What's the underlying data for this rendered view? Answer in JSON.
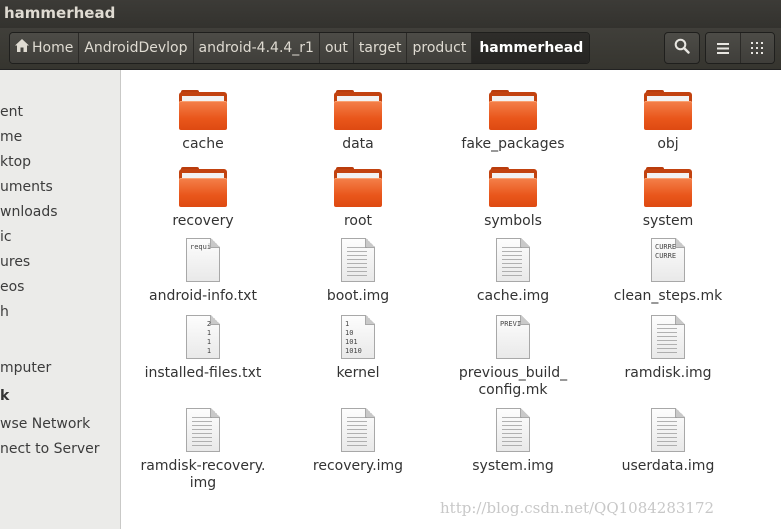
{
  "window": {
    "title": "hammerhead"
  },
  "breadcrumb": {
    "items": [
      "Home",
      "AndroidDevlop",
      "android-4.4.4_r1",
      "out",
      "target",
      "product",
      "hammerhead"
    ]
  },
  "toolbar": {
    "search_icon": "search-icon",
    "list_view_icon": "list-view-icon",
    "grid_view_icon": "grid-view-icon"
  },
  "sidebar": {
    "items": [
      "ent",
      "me",
      "ktop",
      "uments",
      "wnloads",
      "ic",
      "ures",
      "eos",
      "h",
      "mputer",
      "k",
      "wse Network",
      "nect to Server"
    ]
  },
  "files": [
    {
      "name": "cache",
      "type": "folder"
    },
    {
      "name": "data",
      "type": "folder"
    },
    {
      "name": "fake_packages",
      "type": "folder"
    },
    {
      "name": "obj",
      "type": "folder"
    },
    {
      "name": "recovery",
      "type": "folder"
    },
    {
      "name": "root",
      "type": "folder"
    },
    {
      "name": "symbols",
      "type": "folder"
    },
    {
      "name": "system",
      "type": "folder"
    },
    {
      "name": "android-info.txt",
      "type": "text",
      "preview": "requi"
    },
    {
      "name": "boot.img",
      "type": "file"
    },
    {
      "name": "cache.img",
      "type": "file"
    },
    {
      "name": "clean_steps.mk",
      "type": "text",
      "preview": "CURRE\nCURRE"
    },
    {
      "name": "installed-files.txt",
      "type": "text",
      "preview": "    2\n    1\n    1\n    1"
    },
    {
      "name": "kernel",
      "type": "text",
      "preview": "1\n10\n101\n1010"
    },
    {
      "name": "previous_build_\nconfig.mk",
      "type": "text",
      "preview": "PREVI"
    },
    {
      "name": "ramdisk.img",
      "type": "file"
    },
    {
      "name": "ramdisk-recovery.\nimg",
      "type": "file"
    },
    {
      "name": "recovery.img",
      "type": "file"
    },
    {
      "name": "system.img",
      "type": "file"
    },
    {
      "name": "userdata.img",
      "type": "file"
    }
  ],
  "watermark": "http://blog.csdn.net/QQ1084283172"
}
